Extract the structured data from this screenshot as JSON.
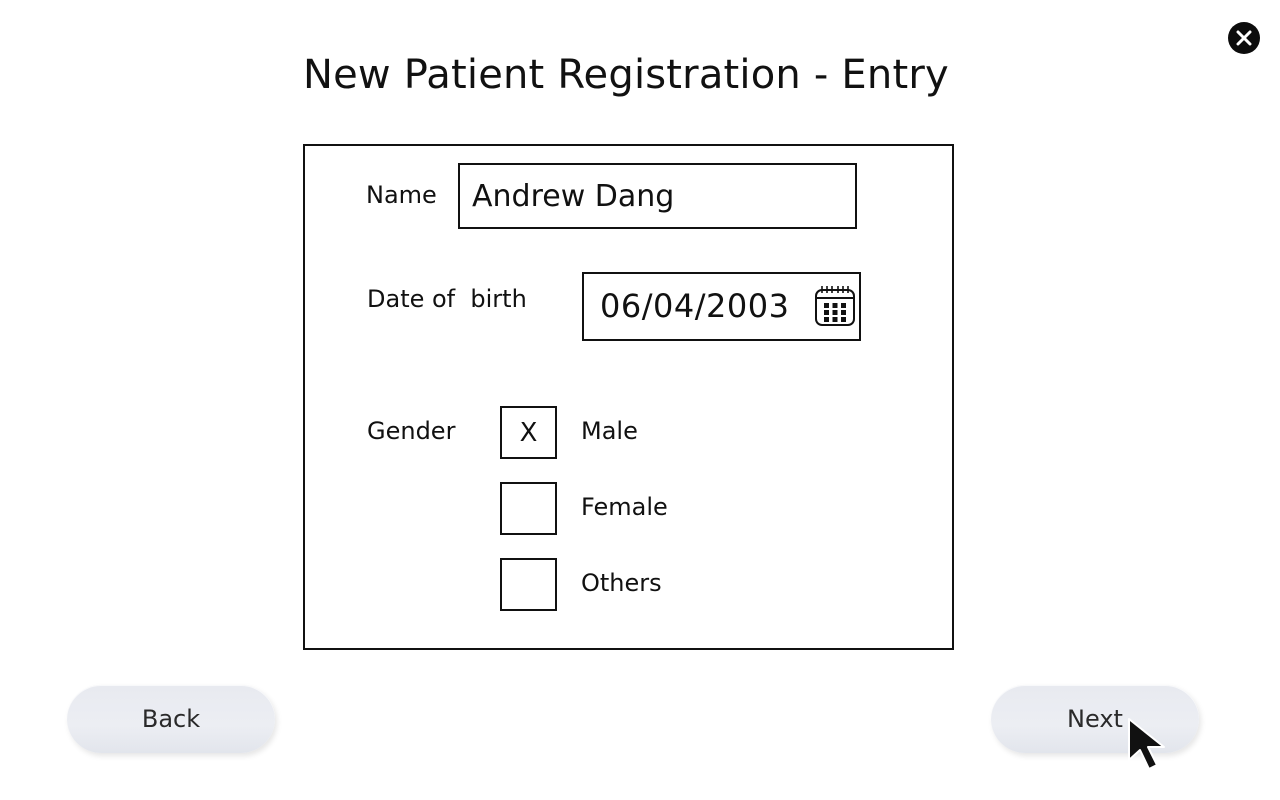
{
  "form": {
    "title": "New Patient Registration - Entry",
    "name_label": "Name",
    "name_value": "Andrew Dang",
    "dob_label": "Date of  birth",
    "dob_value": "06/04/2003",
    "gender_label": "Gender",
    "gender_options": [
      {
        "label": "Male",
        "mark": "X",
        "checked": true
      },
      {
        "label": "Female",
        "mark": "",
        "checked": false
      },
      {
        "label": "Others",
        "mark": "",
        "checked": false
      }
    ]
  },
  "nav": {
    "back_label": "Back",
    "next_label": "Next"
  },
  "icons": {
    "close": "close-icon",
    "calendar": "calendar-icon",
    "cursor": "mouse-pointer-icon"
  },
  "colors": {
    "button_bg": "#e8eaf0",
    "close_bg": "#0c0c0c",
    "border": "#111111"
  }
}
